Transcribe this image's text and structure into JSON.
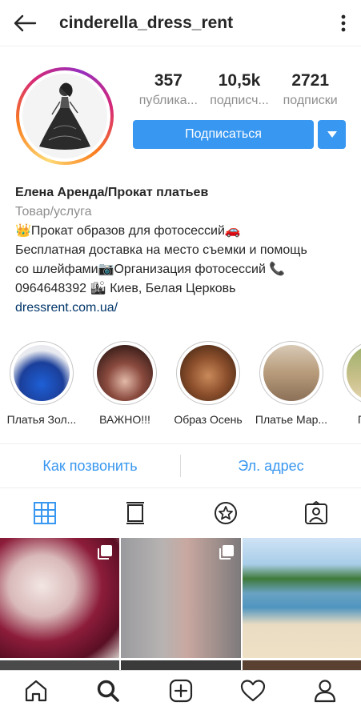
{
  "header": {
    "username": "cinderella_dress_rent",
    "back_icon": "arrow-left-icon",
    "menu_icon": "more-vertical-icon"
  },
  "profile": {
    "stats": [
      {
        "value": "357",
        "label": "публика..."
      },
      {
        "value": "10,5k",
        "label": "подписч..."
      },
      {
        "value": "2721",
        "label": "подписки"
      }
    ],
    "follow_label": "Подписаться",
    "name": "Елена Аренда/Прокат платьев",
    "category": "Товар/услуга",
    "bio_lines": [
      "👑Прокат образов для фотосессий🚗",
      "Бесплатная доставка на место съемки и помощь",
      "со шлейфами📷Организация фотосессий 📞",
      "0964648392 🏙 Киев, Белая Церковь"
    ],
    "link": "dressrent.com.ua/"
  },
  "highlights": [
    {
      "label": "Платья Зол..."
    },
    {
      "label": "ВАЖНО!!!"
    },
    {
      "label": "Образ Осень"
    },
    {
      "label": "Платье Мар..."
    },
    {
      "label": "Плат..."
    }
  ],
  "contact": {
    "call_label": "Как позвонить",
    "email_label": "Эл. адрес"
  },
  "tabs": [
    "grid-icon",
    "feed-icon",
    "star-badge-icon",
    "tagged-icon"
  ],
  "colors": {
    "accent": "#3897f0",
    "link": "#003569",
    "secondary_text": "#8e8e8e"
  },
  "bottom_nav": [
    "home-icon",
    "search-icon",
    "add-icon",
    "heart-icon",
    "profile-icon"
  ]
}
